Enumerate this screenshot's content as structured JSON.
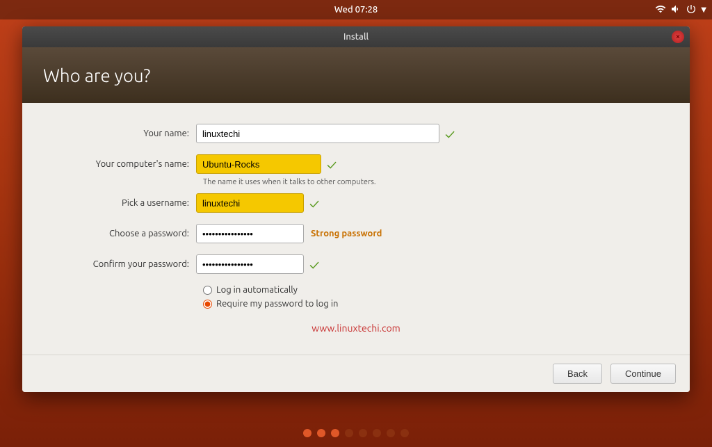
{
  "topbar": {
    "time": "Wed 07:28",
    "icons": [
      "network-icon",
      "volume-icon",
      "power-icon"
    ]
  },
  "window": {
    "title": "Install",
    "close_label": "×"
  },
  "header": {
    "title": "Who are you?"
  },
  "form": {
    "name_label": "Your name:",
    "name_value": "linuxtechi",
    "computer_label": "Your computer's name:",
    "computer_value": "Ubuntu-Rocks",
    "computer_hint": "The name it uses when it talks to other computers.",
    "username_label": "Pick a username:",
    "username_value": "linuxtechi",
    "password_label": "Choose a password:",
    "password_value": "••••••••••••••",
    "password_strength": "Strong password",
    "confirm_label": "Confirm your password:",
    "confirm_value": "••••••••••••••",
    "radio_auto": "Log in automatically",
    "radio_require": "Require my password to log in"
  },
  "watermark": {
    "text": "www.linuxtechi.com",
    "url": "#"
  },
  "buttons": {
    "back": "Back",
    "continue": "Continue"
  },
  "pagination": {
    "dots": [
      {
        "active": true
      },
      {
        "active": true
      },
      {
        "active": true
      },
      {
        "active": false
      },
      {
        "active": false
      },
      {
        "active": false
      },
      {
        "active": false
      },
      {
        "active": false
      }
    ]
  }
}
